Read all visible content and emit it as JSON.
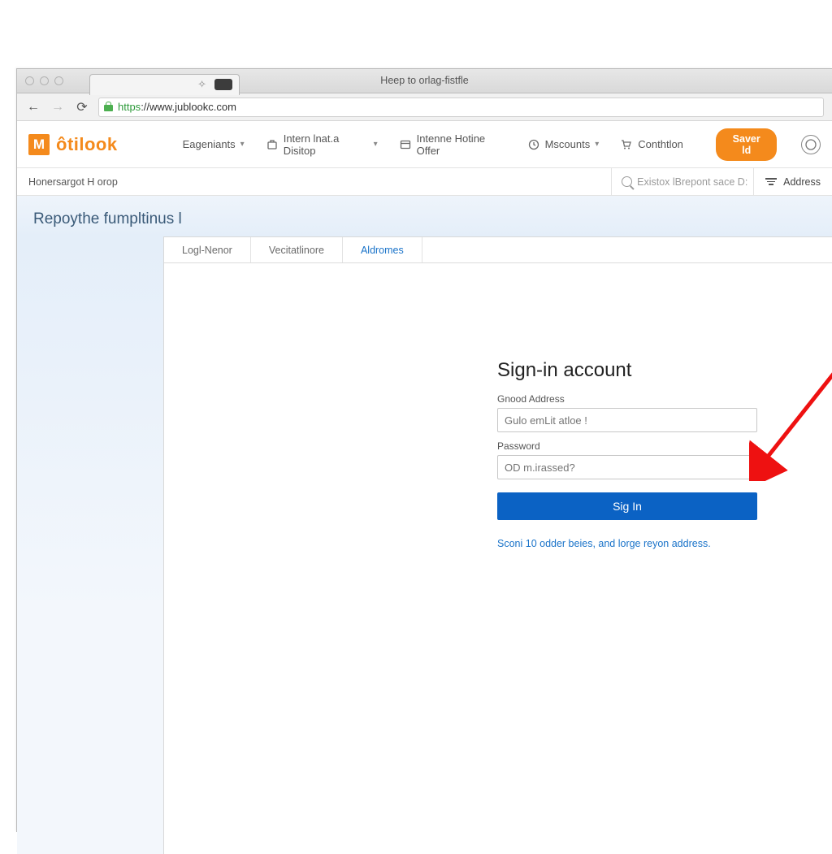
{
  "browser": {
    "page_title": "Heep to orlag-fistfle",
    "url_scheme": "https",
    "url_rest": "://www.jublookc.com"
  },
  "header": {
    "logo_letter": "M",
    "logo_text": "ôtilook",
    "nav": [
      {
        "label": "Eageniants",
        "has_icon": false
      },
      {
        "label": "Intern lnat.a Disitop",
        "has_icon": true,
        "icon": "bag-icon"
      },
      {
        "label": "Intenne Hotine Offer",
        "has_icon": true,
        "icon": "box-icon"
      },
      {
        "label": "Mscounts",
        "has_icon": true,
        "icon": "clock-icon"
      },
      {
        "label": "Conthtlon",
        "has_icon": true,
        "icon": "cart-icon"
      }
    ],
    "cta": "Saver ld"
  },
  "subbar": {
    "crumb": "Honersargot H orop",
    "search_placeholder": "Existox lBrepont sace D:",
    "filter_label": "Address"
  },
  "page": {
    "heading": "Repoythe fumpltinus l",
    "tabs": [
      {
        "label": "Logl-Nenor",
        "active": false
      },
      {
        "label": "Vecitatlinore",
        "active": false
      },
      {
        "label": "Aldromes",
        "active": true
      }
    ]
  },
  "signin": {
    "title": "Sign-in account",
    "email_label": "Gnood Address",
    "email_placeholder": "Gulo emLit atloe !",
    "password_label": "Password",
    "password_placeholder": "OD m.irassed?",
    "button": "Sig In",
    "help": "Sconi 10 odder beies, and lorge reyon address."
  },
  "colors": {
    "accent": "#f48a1c",
    "primary": "#0b62c4",
    "link": "#1a73c9"
  }
}
